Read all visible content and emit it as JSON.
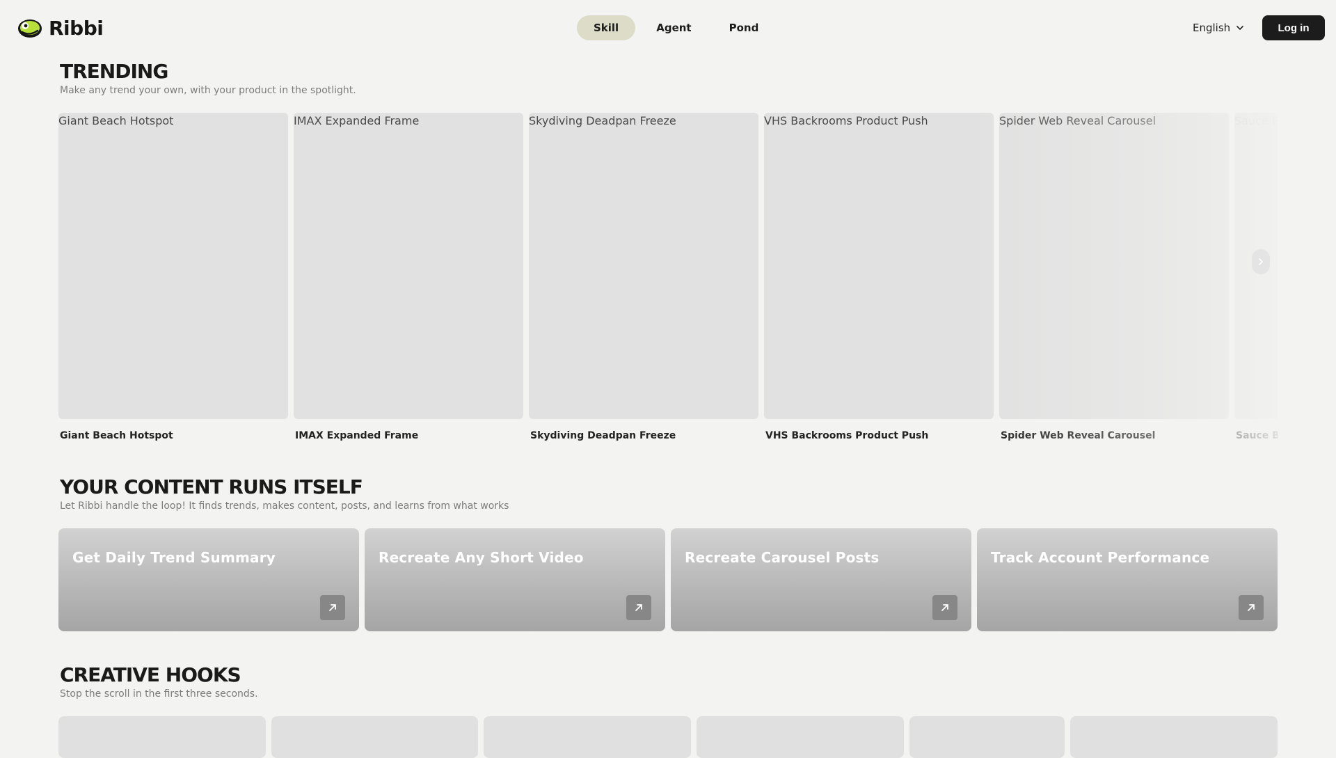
{
  "header": {
    "logo_text": "Ribbi",
    "nav": [
      {
        "label": "Skill",
        "active": true
      },
      {
        "label": "Agent",
        "active": false
      },
      {
        "label": "Pond",
        "active": false
      }
    ],
    "language": "English",
    "login_label": "Log in"
  },
  "trending": {
    "title": "TRENDING",
    "subtitle": "Make any trend your own, with your product in the spotlight.",
    "items": [
      {
        "alt": "Giant Beach Hotspot",
        "label": "Giant Beach Hotspot"
      },
      {
        "alt": "IMAX Expanded Frame",
        "label": "IMAX Expanded Frame"
      },
      {
        "alt": "Skydiving Deadpan Freeze",
        "label": "Skydiving Deadpan Freeze"
      },
      {
        "alt": "VHS Backrooms Product Push",
        "label": "VHS Backrooms Product Push"
      },
      {
        "alt": "Spider Web Reveal Carousel",
        "label": "Spider Web Reveal Carousel"
      },
      {
        "alt": "Sauce Bi",
        "label": "Sauce Bi"
      }
    ]
  },
  "content": {
    "title": "YOUR CONTENT RUNS ITSELF",
    "subtitle": "Let Ribbi handle the loop! It finds trends, makes content, posts, and learns from what works",
    "cards": [
      {
        "title": "Get Daily Trend Summary"
      },
      {
        "title": "Recreate Any Short Video"
      },
      {
        "title": "Recreate Carousel Posts"
      },
      {
        "title": "Track Account Performance"
      }
    ]
  },
  "hooks": {
    "title": "CREATIVE HOOKS",
    "subtitle": "Stop the scroll in the first three seconds."
  },
  "icons": {
    "logo": "frog-logo-icon",
    "language_toggle": "chevron-down-icon",
    "carousel_next": "chevron-right-icon",
    "card_action": "arrow-up-right-icon"
  },
  "colors": {
    "background": "#f3f3f1",
    "nav_active": "#dcdcc9",
    "login_bg": "#1c1c1c",
    "logo_green": "#b8e03a"
  }
}
